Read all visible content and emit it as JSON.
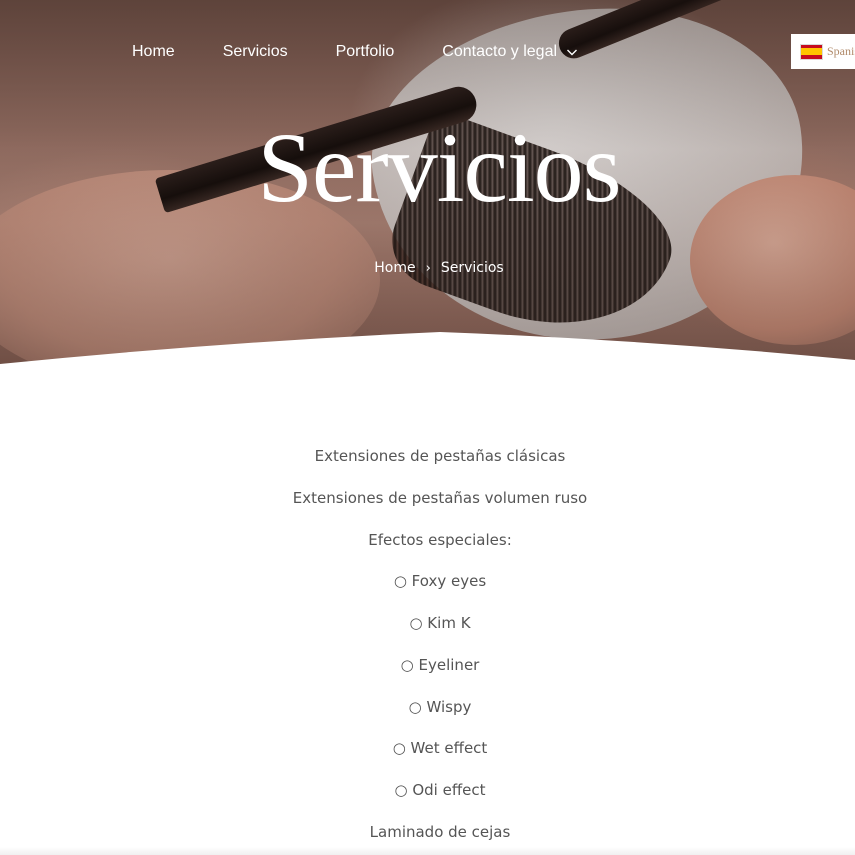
{
  "nav": {
    "items": [
      {
        "label": "Home"
      },
      {
        "label": "Servicios"
      },
      {
        "label": "Portfolio"
      },
      {
        "label": "Contacto y legal"
      }
    ]
  },
  "language": {
    "label": "Spanish",
    "flag_icon": "spain-flag-icon"
  },
  "hero": {
    "title": "Servicios",
    "breadcrumb": {
      "home": "Home",
      "separator": "›",
      "current": "Servicios"
    }
  },
  "services": [
    "Extensiones de pestañas clásicas",
    "Extensiones de pestañas volumen ruso",
    "Efectos especiales:",
    "○ Foxy eyes",
    "○ Kim K",
    "○ Eyeliner",
    "○ Wispy",
    "○ Wet effect",
    "○ Odi effect",
    "Laminado de cejas"
  ],
  "colors": {
    "text_muted": "#555555",
    "hero_text": "#ffffff",
    "language_text": "#b08a6a",
    "background": "#ffffff"
  }
}
